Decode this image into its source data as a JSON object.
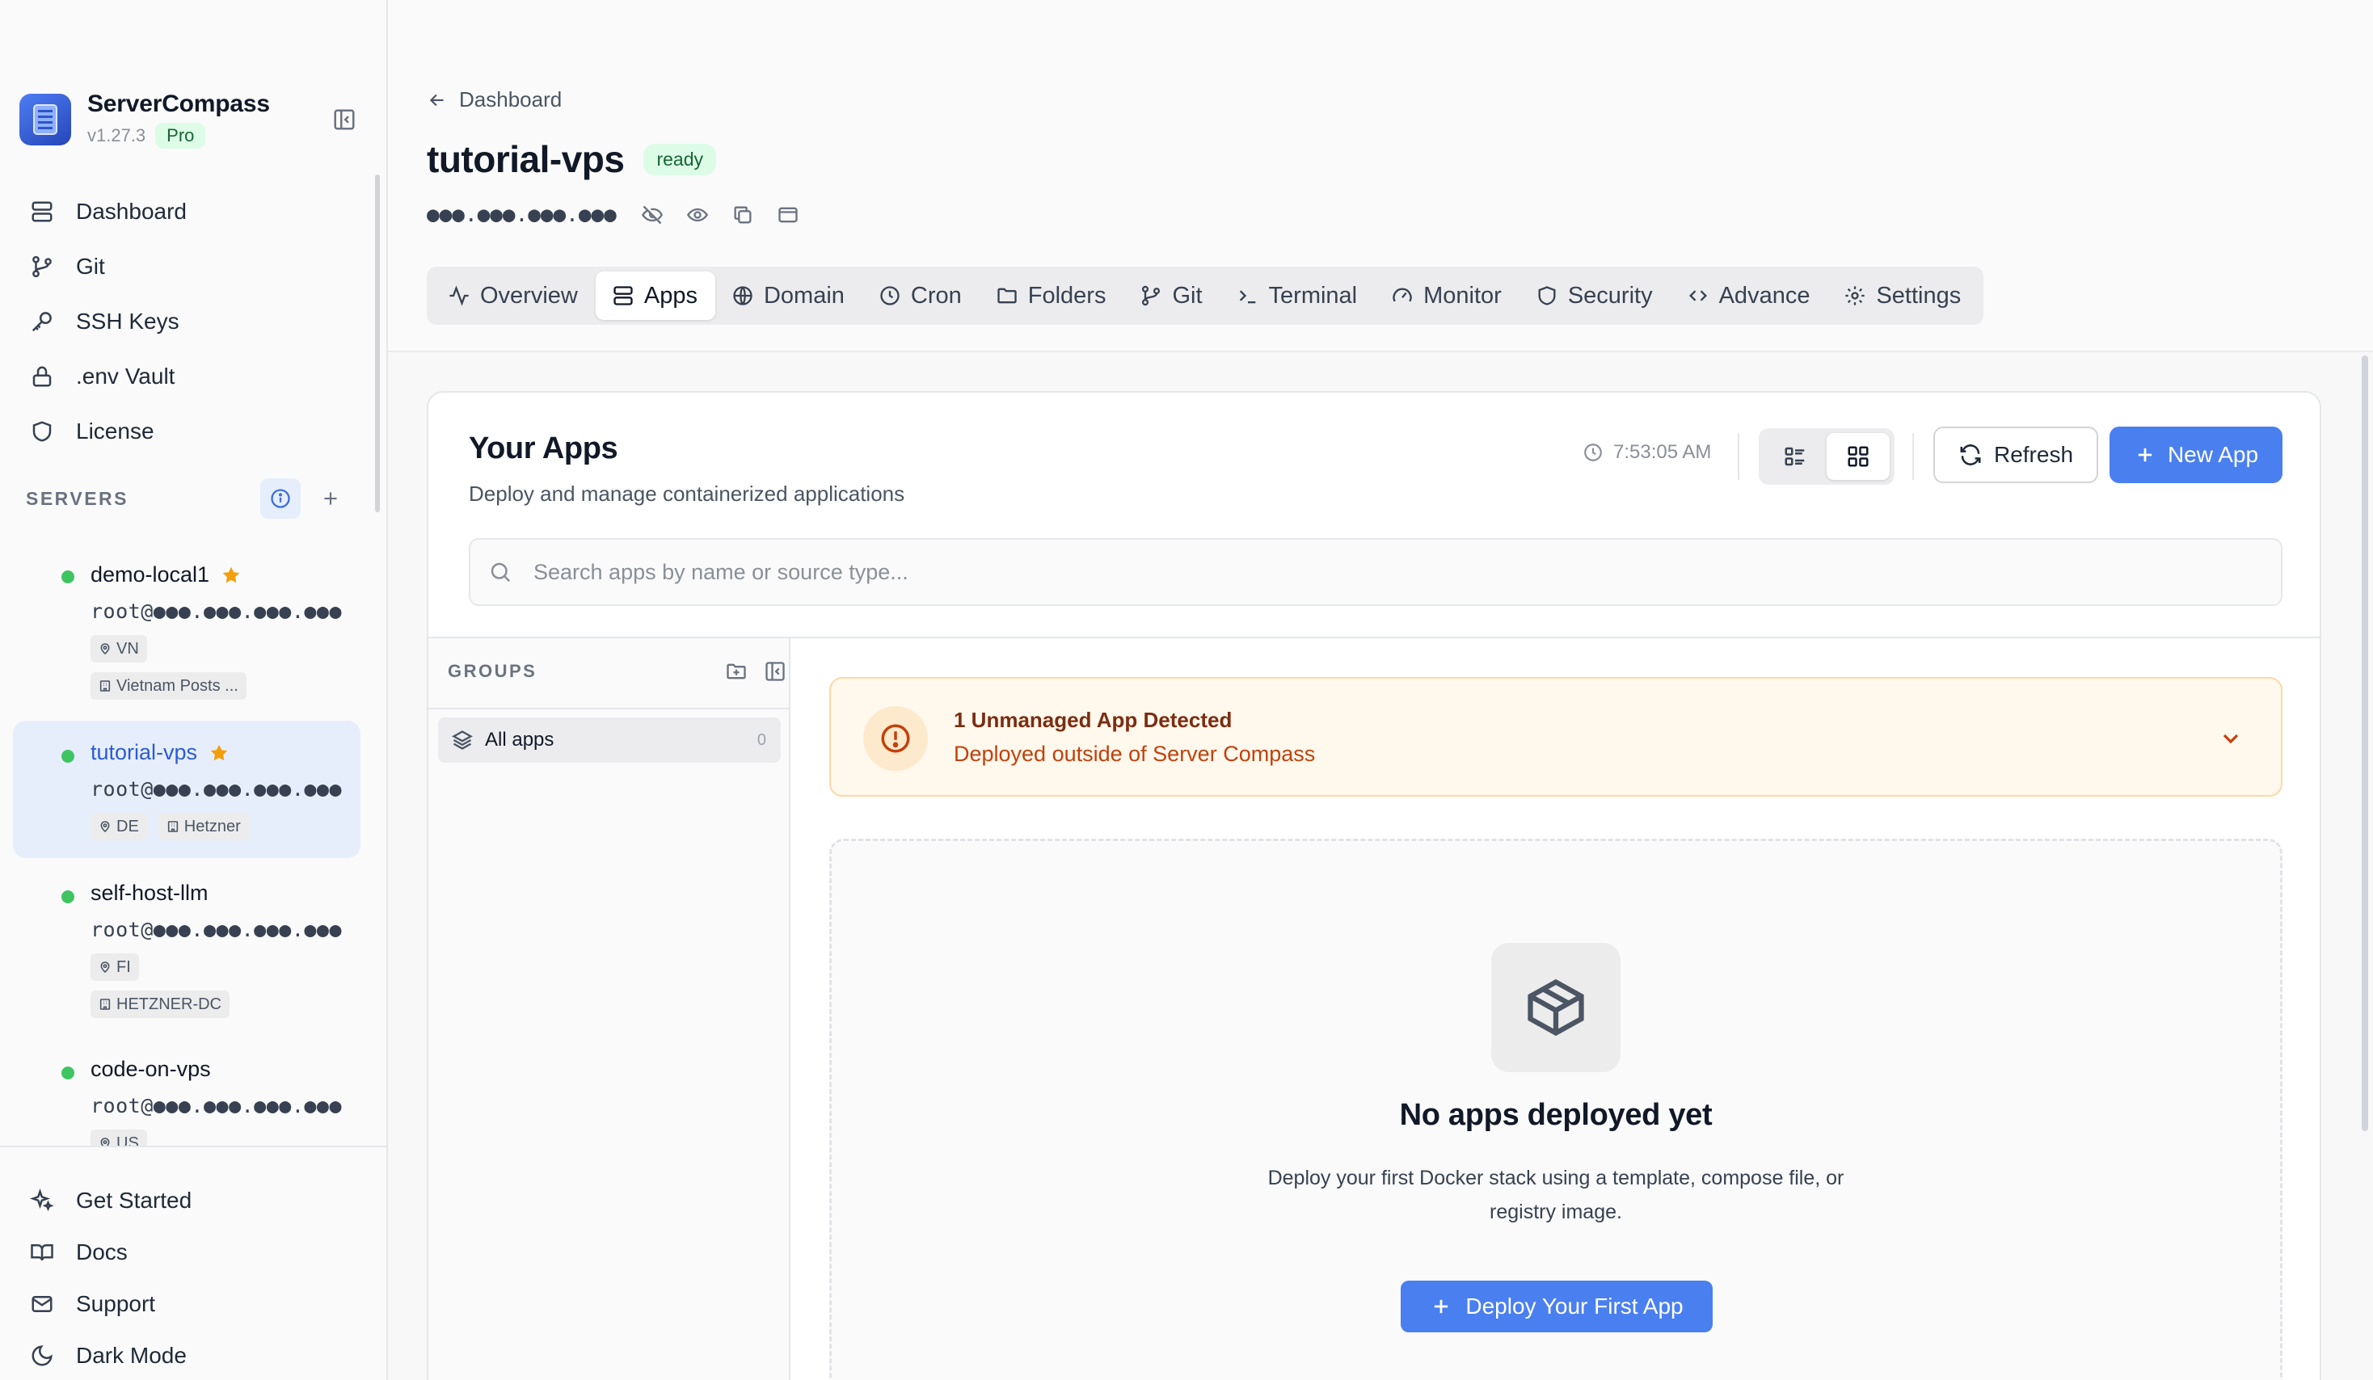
{
  "app": {
    "name": "ServerCompass",
    "version": "v1.27.3",
    "plan_badge": "Pro"
  },
  "sidebar": {
    "nav": [
      {
        "label": "Dashboard",
        "icon": "dashboard-icon"
      },
      {
        "label": "Git",
        "icon": "git-branch-icon"
      },
      {
        "label": "SSH Keys",
        "icon": "key-icon"
      },
      {
        "label": ".env Vault",
        "icon": "lock-icon"
      },
      {
        "label": "License",
        "icon": "shield-icon"
      }
    ],
    "servers_title": "SERVERS",
    "servers": [
      {
        "name": "demo-local1",
        "ip": "root@●●●.●●●.●●●.●●●",
        "location": "VN",
        "provider": "Vietnam Posts ...",
        "favorite": true,
        "status": "online"
      },
      {
        "name": "tutorial-vps",
        "ip": "root@●●●.●●●.●●●.●●●",
        "location": "DE",
        "provider": "Hetzner",
        "favorite": true,
        "status": "online",
        "active": true
      },
      {
        "name": "self-host-llm",
        "ip": "root@●●●.●●●.●●●.●●●",
        "location": "FI",
        "provider": "HETZNER-DC",
        "favorite": false,
        "status": "online"
      },
      {
        "name": "code-on-vps",
        "ip": "root@●●●.●●●.●●●.●●●",
        "location": "US",
        "provider": "",
        "favorite": false,
        "status": "online"
      }
    ],
    "bottom": [
      {
        "label": "Get Started",
        "icon": "sparkles-icon"
      },
      {
        "label": "Docs",
        "icon": "book-icon"
      },
      {
        "label": "Support",
        "icon": "mail-icon"
      },
      {
        "label": "Dark Mode",
        "icon": "moon-icon"
      }
    ]
  },
  "header": {
    "breadcrumb": "Dashboard",
    "title": "tutorial-vps",
    "status": "ready",
    "masked_ip": "●●●.●●●.●●●.●●●",
    "tabs": [
      {
        "label": "Overview",
        "icon": "activity-icon"
      },
      {
        "label": "Apps",
        "icon": "server-stack-icon",
        "active": true
      },
      {
        "label": "Domain",
        "icon": "globe-icon"
      },
      {
        "label": "Cron",
        "icon": "clock-icon"
      },
      {
        "label": "Folders",
        "icon": "folder-icon"
      },
      {
        "label": "Git",
        "icon": "git-branch-icon"
      },
      {
        "label": "Terminal",
        "icon": "terminal-icon"
      },
      {
        "label": "Monitor",
        "icon": "gauge-icon"
      },
      {
        "label": "Security",
        "icon": "shield-icon"
      },
      {
        "label": "Advance",
        "icon": "code-icon"
      },
      {
        "label": "Settings",
        "icon": "gear-icon"
      }
    ]
  },
  "apps": {
    "title": "Your Apps",
    "subtitle": "Deploy and manage containerized applications",
    "last_updated": "7:53:05 AM",
    "view_mode": "grid",
    "refresh_label": "Refresh",
    "new_app_label": "New App",
    "search_placeholder": "Search apps by name or source type...",
    "search_value": "",
    "groups_title": "GROUPS",
    "groups": [
      {
        "label": "All apps",
        "count": "0"
      }
    ],
    "alert": {
      "title": "1 Unmanaged App Detected",
      "subtitle": "Deployed outside of Server Compass"
    },
    "empty": {
      "title": "No apps deployed yet",
      "description": "Deploy your first Docker stack using a template, compose file, or registry image.",
      "button": "Deploy Your First App"
    }
  },
  "colors": {
    "accent": "#4a7ff0",
    "status_online": "#3fc462",
    "star": "#f59e0b",
    "alert_bg": "#fff8ec",
    "alert_text": "#c2410c"
  }
}
